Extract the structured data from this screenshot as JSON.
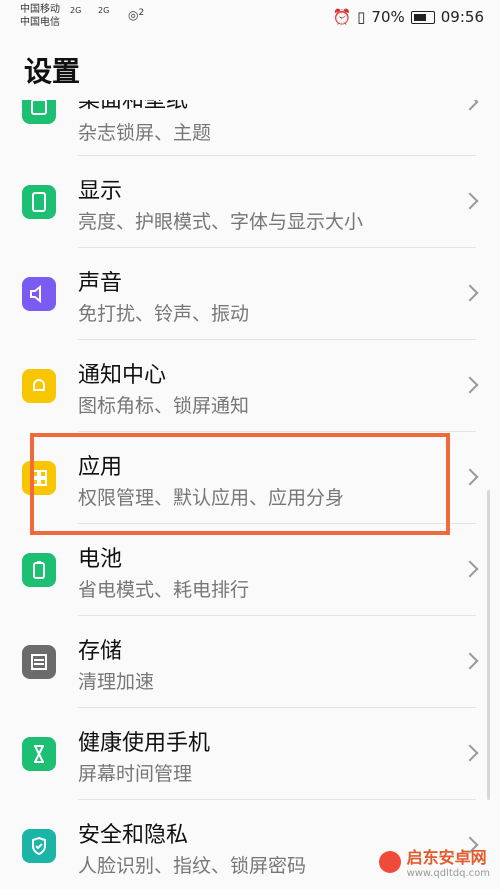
{
  "status": {
    "carrier1": "中国移动",
    "carrier2": "中国电信",
    "net1": "2G",
    "net2": "2G",
    "wifi_label": "2",
    "battery": "70%",
    "time": "09:56"
  },
  "page": {
    "title": "设置"
  },
  "items": [
    {
      "title": "桌面和壁纸",
      "subtitle": "杂志锁屏、主题",
      "icon": "wallpaper-icon",
      "color": "#1dbf73"
    },
    {
      "title": "显示",
      "subtitle": "亮度、护眼模式、字体与显示大小",
      "icon": "display-icon",
      "color": "#1dbf73"
    },
    {
      "title": "声音",
      "subtitle": "免打扰、铃声、振动",
      "icon": "sound-icon",
      "color": "#7b5cf2"
    },
    {
      "title": "通知中心",
      "subtitle": "图标角标、锁屏通知",
      "icon": "bell-icon",
      "color": "#f7c600"
    },
    {
      "title": "应用",
      "subtitle": "权限管理、默认应用、应用分身",
      "icon": "apps-icon",
      "color": "#f7c600"
    },
    {
      "title": "电池",
      "subtitle": "省电模式、耗电排行",
      "icon": "battery-icon",
      "color": "#1dbf73"
    },
    {
      "title": "存储",
      "subtitle": "清理加速",
      "icon": "storage-icon",
      "color": "#6b6b6b"
    },
    {
      "title": "健康使用手机",
      "subtitle": "屏幕时间管理",
      "icon": "hourglass-icon",
      "color": "#1dbf73"
    },
    {
      "title": "安全和隐私",
      "subtitle": "人脸识别、指纹、锁屏密码",
      "icon": "shield-icon",
      "color": "#1ab5a6"
    }
  ],
  "watermark": {
    "brand": "启东安卓网",
    "url": "www.qdltdq.com"
  },
  "highlight_color": "#f06a3a"
}
